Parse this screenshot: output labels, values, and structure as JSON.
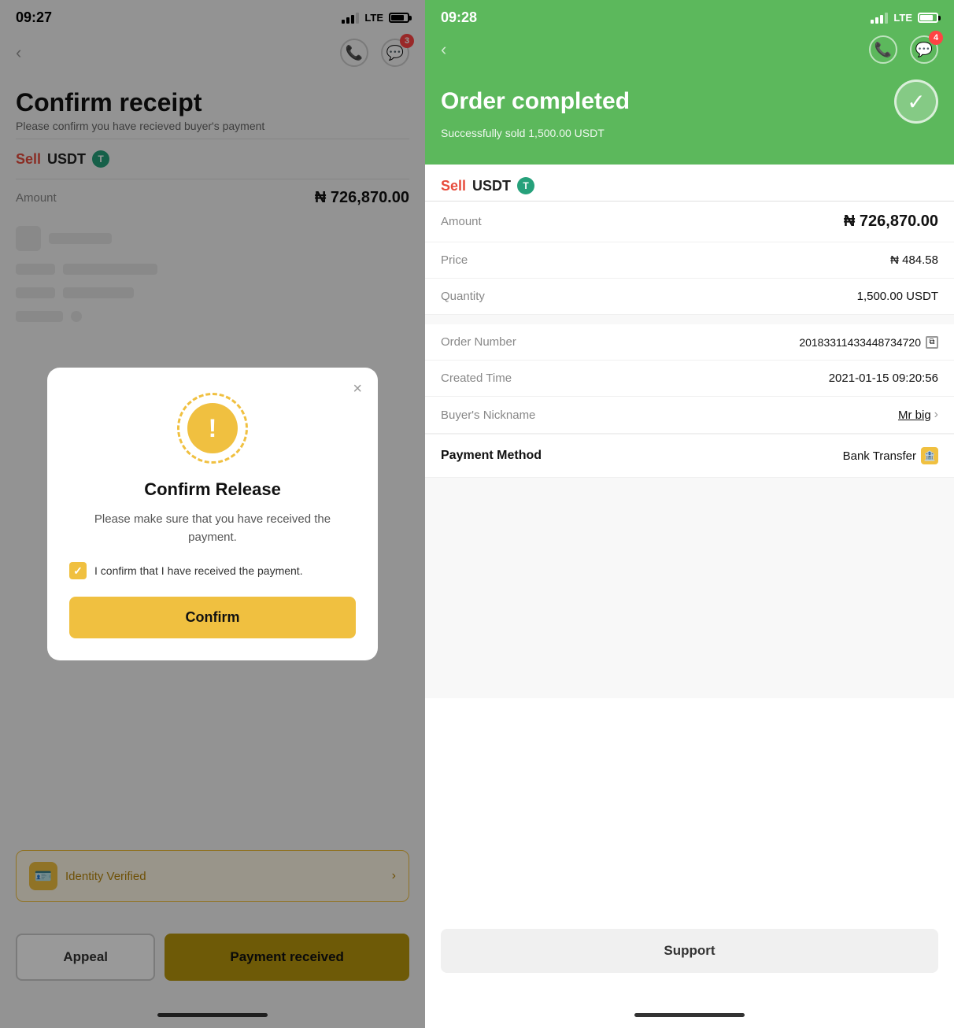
{
  "left": {
    "status_time": "09:27",
    "signal": "●●",
    "lte": "LTE",
    "page_title": "Confirm receipt",
    "page_subtitle": "Please confirm you have recieved buyer's payment",
    "sell_label": "Sell",
    "currency": "USDT",
    "amount_label": "Amount",
    "amount_value": "₦ 726,870.00",
    "identity_text": "Identity Verified",
    "btn_appeal": "Appeal",
    "btn_payment": "Payment received"
  },
  "modal": {
    "close_label": "×",
    "title": "Confirm Release",
    "description": "Please make sure that you have received the payment.",
    "checkbox_text": "I confirm that I have received the payment.",
    "confirm_btn": "Confirm"
  },
  "right": {
    "status_time": "09:28",
    "lte": "LTE",
    "badge_count": "4",
    "order_completed_title": "Order completed",
    "order_completed_sub": "Successfully sold 1,500.00 USDT",
    "sell_label": "Sell",
    "currency": "USDT",
    "amount_label": "Amount",
    "amount_value": "₦ 726,870.00",
    "price_label": "Price",
    "price_value": "₦ 484.58",
    "quantity_label": "Quantity",
    "quantity_value": "1,500.00 USDT",
    "order_number_label": "Order Number",
    "order_number_value": "20183311433448734720",
    "created_time_label": "Created Time",
    "created_time_value": "2021-01-15 09:20:56",
    "buyer_label": "Buyer's Nickname",
    "buyer_value": "Mr big",
    "payment_method_label": "Payment Method",
    "payment_method_value": "Bank Transfer",
    "support_btn": "Support"
  }
}
